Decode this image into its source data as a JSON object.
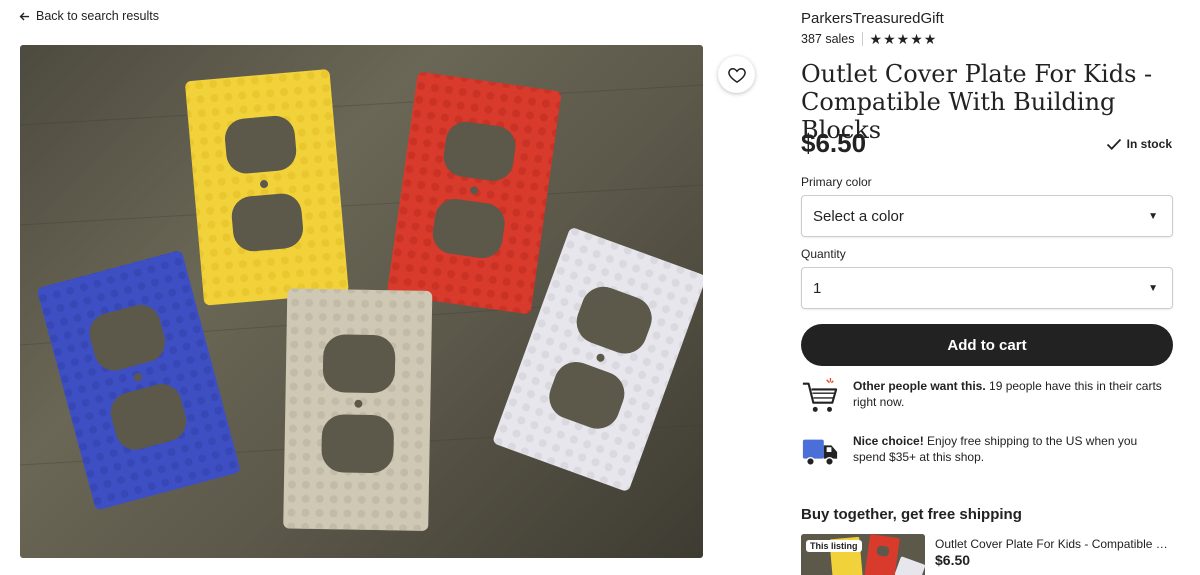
{
  "nav": {
    "back_label": "Back to search results"
  },
  "listing": {
    "shop_name": "ParkersTreasuredGift",
    "sales": "387 sales",
    "rating_stars": 5,
    "title": "Outlet Cover Plate For Kids - Compatible With Building Blocks",
    "price": "$6.50",
    "stock_status": "In stock"
  },
  "options": {
    "color_label": "Primary color",
    "color_value": "Select a color",
    "quantity_label": "Quantity",
    "quantity_value": "1"
  },
  "actions": {
    "add_to_cart": "Add to cart"
  },
  "info": {
    "carts_bold": "Other people want this.",
    "carts_text": "19 people have this in their carts right now.",
    "shipping_bold": "Nice choice!",
    "shipping_text": "Enjoy free shipping to the US when you spend $35+ at this shop."
  },
  "bundle": {
    "heading": "Buy together, get free shipping",
    "tag": "This listing",
    "item_name": "Outlet Cover Plate For Kids - Compatible With Building Blocks",
    "item_price": "$6.50"
  },
  "icons": {
    "back": "arrow-left-icon",
    "favorite": "heart-icon",
    "stock": "checkmark-icon",
    "carts": "shopping-cart-icon",
    "shipping": "delivery-truck-icon",
    "caret": "chevron-down-icon"
  },
  "colors": {
    "text": "#222222",
    "button_bg": "#222222",
    "plate_yellow": "#f2d23a",
    "plate_red": "#d83a2c",
    "plate_blue": "#3e4fc4",
    "plate_tan": "#cfc8b4",
    "plate_white": "#e7e6ec"
  }
}
